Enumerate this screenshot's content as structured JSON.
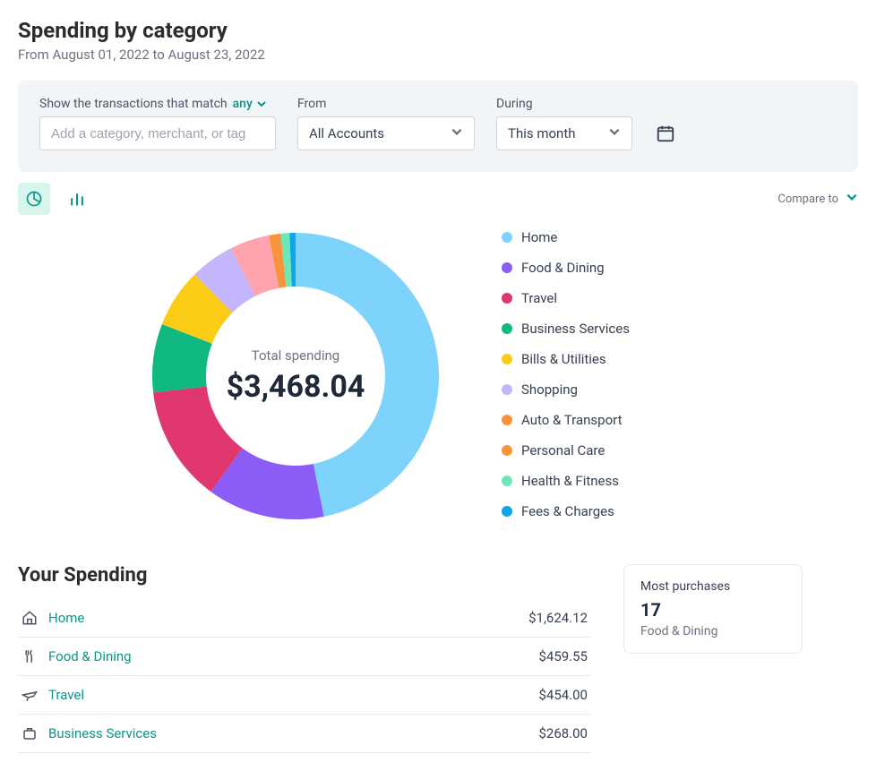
{
  "header": {
    "title": "Spending by category",
    "date_range": "From August 01, 2022 to August 23, 2022"
  },
  "filter": {
    "match_label": "Show the transactions that match",
    "any_label": "any",
    "tag_placeholder": "Add a category, merchant, or tag",
    "from_label": "From",
    "from_value": "All Accounts",
    "during_label": "During",
    "during_value": "This month"
  },
  "compare_label": "Compare to",
  "chart_center": {
    "label": "Total spending",
    "value": "$3,468.04"
  },
  "legend_items": [
    {
      "label": "Home",
      "color": "#7dd3fc"
    },
    {
      "label": "Food & Dining",
      "color": "#8b5cf6"
    },
    {
      "label": "Travel",
      "color": "#e0376f"
    },
    {
      "label": "Business Services",
      "color": "#10b981"
    },
    {
      "label": "Bills & Utilities",
      "color": "#facc15"
    },
    {
      "label": "Shopping",
      "color": "#c4b5fd"
    },
    {
      "label": "Auto & Transport",
      "color": "#fb923c"
    },
    {
      "label": "Personal Care",
      "color": "#fb923c"
    },
    {
      "label": "Health & Fitness",
      "color": "#6ee7b7"
    },
    {
      "label": "Fees & Charges",
      "color": "#0ea5e9"
    }
  ],
  "spending": {
    "title": "Your Spending",
    "rows": [
      {
        "name": "Home",
        "amount": "$1,624.12"
      },
      {
        "name": "Food & Dining",
        "amount": "$459.55"
      },
      {
        "name": "Travel",
        "amount": "$454.00"
      },
      {
        "name": "Business Services",
        "amount": "$268.00"
      }
    ]
  },
  "most_purchases": {
    "title": "Most purchases",
    "count": "17",
    "category": "Food & Dining"
  },
  "chart_data": {
    "type": "pie",
    "title": "Spending by category",
    "total_label": "Total spending",
    "total": 3468.04,
    "series": [
      {
        "name": "Home",
        "value": 1624.12,
        "color": "#7dd3fc"
      },
      {
        "name": "Food & Dining",
        "value": 459.55,
        "color": "#8b5cf6"
      },
      {
        "name": "Travel",
        "value": 454.0,
        "color": "#e0376f"
      },
      {
        "name": "Business Services",
        "value": 268.0,
        "color": "#10b981"
      },
      {
        "name": "Bills & Utilities",
        "value": 230.0,
        "color": "#facc15"
      },
      {
        "name": "Shopping",
        "value": 174.0,
        "color": "#c4b5fd"
      },
      {
        "name": "Auto & Transport",
        "value": 155.0,
        "color": "#fda4af"
      },
      {
        "name": "Personal Care",
        "value": 45.0,
        "color": "#fb923c"
      },
      {
        "name": "Health & Fitness",
        "value": 35.0,
        "color": "#6ee7b7"
      },
      {
        "name": "Fees & Charges",
        "value": 23.37,
        "color": "#0ea5e9"
      }
    ]
  }
}
